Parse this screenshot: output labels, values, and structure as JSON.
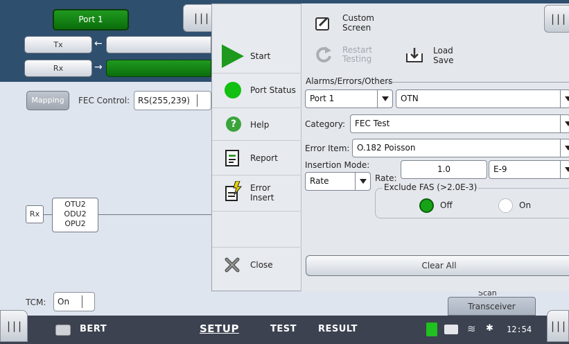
{
  "port_button": "Port 1",
  "tx_label": "Tx",
  "rx_label": "Rx",
  "mapping_button": "Mapping",
  "fec_control_label": "FEC Control:",
  "fec_control_value": "RS(255,239)",
  "rx_small": "Rx",
  "otu_stack": [
    "OTU2",
    "ODU2",
    "OPU2"
  ],
  "tcm_label": "TCM:",
  "tcm_value": "On",
  "scan_label": "Scan",
  "transceiver_button": "Transceiver",
  "menu": {
    "start": "Start",
    "port_status": "Port Status",
    "help": "Help",
    "report": "Report",
    "error_insert_1": "Error",
    "error_insert_2": "Insert",
    "close": "Close"
  },
  "panel": {
    "custom_screen_1": "Custom",
    "custom_screen_2": "Screen",
    "restart_testing_1": "Restart",
    "restart_testing_2": "Testing",
    "load_save_1": "Load",
    "load_save_2": "Save",
    "alarms_title": "Alarms/Errors/Others",
    "port_select": "Port 1",
    "otn_select": "OTN",
    "category_label": "Category:",
    "category_value": "FEC Test",
    "error_item_label": "Error Item:",
    "error_item_value": "O.182 Poisson",
    "insertion_mode_label": "Insertion Mode:",
    "insertion_mode_value": "Rate",
    "rate_label": "Rate:",
    "rate_value": "1.0",
    "rate_exp": "E-9",
    "exclude_fas_title": "Exclude FAS (>2.0E-3)",
    "off_label": "Off",
    "on_label": "On",
    "exclude_fas_selected": "Off",
    "clear_all": "Clear All"
  },
  "statusbar": {
    "app": "BERT",
    "setup": "SETUP",
    "test": "TEST",
    "result": "RESULT",
    "time": "12:54"
  },
  "colors": {
    "accent_green": "#1f9a1f",
    "panel_bg": "#e4e8ed",
    "statusbar_bg": "#3c4250",
    "background_blue": "#2f4f6f"
  }
}
